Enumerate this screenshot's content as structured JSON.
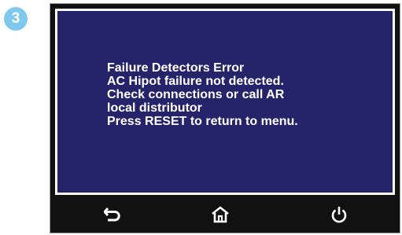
{
  "step": {
    "number": "3",
    "color": "#7fc9ee"
  },
  "screen": {
    "background": "#25246a",
    "message_lines": [
      "Failure Detectors Error",
      "AC Hipot failure not detected.",
      "Check connections or call AR",
      "local distributor",
      "Press RESET to return to menu."
    ]
  },
  "footer": {
    "buttons": [
      {
        "name": "back",
        "icon": "back-arrow-icon"
      },
      {
        "name": "home",
        "icon": "home-icon"
      },
      {
        "name": "power",
        "icon": "power-icon"
      }
    ]
  }
}
